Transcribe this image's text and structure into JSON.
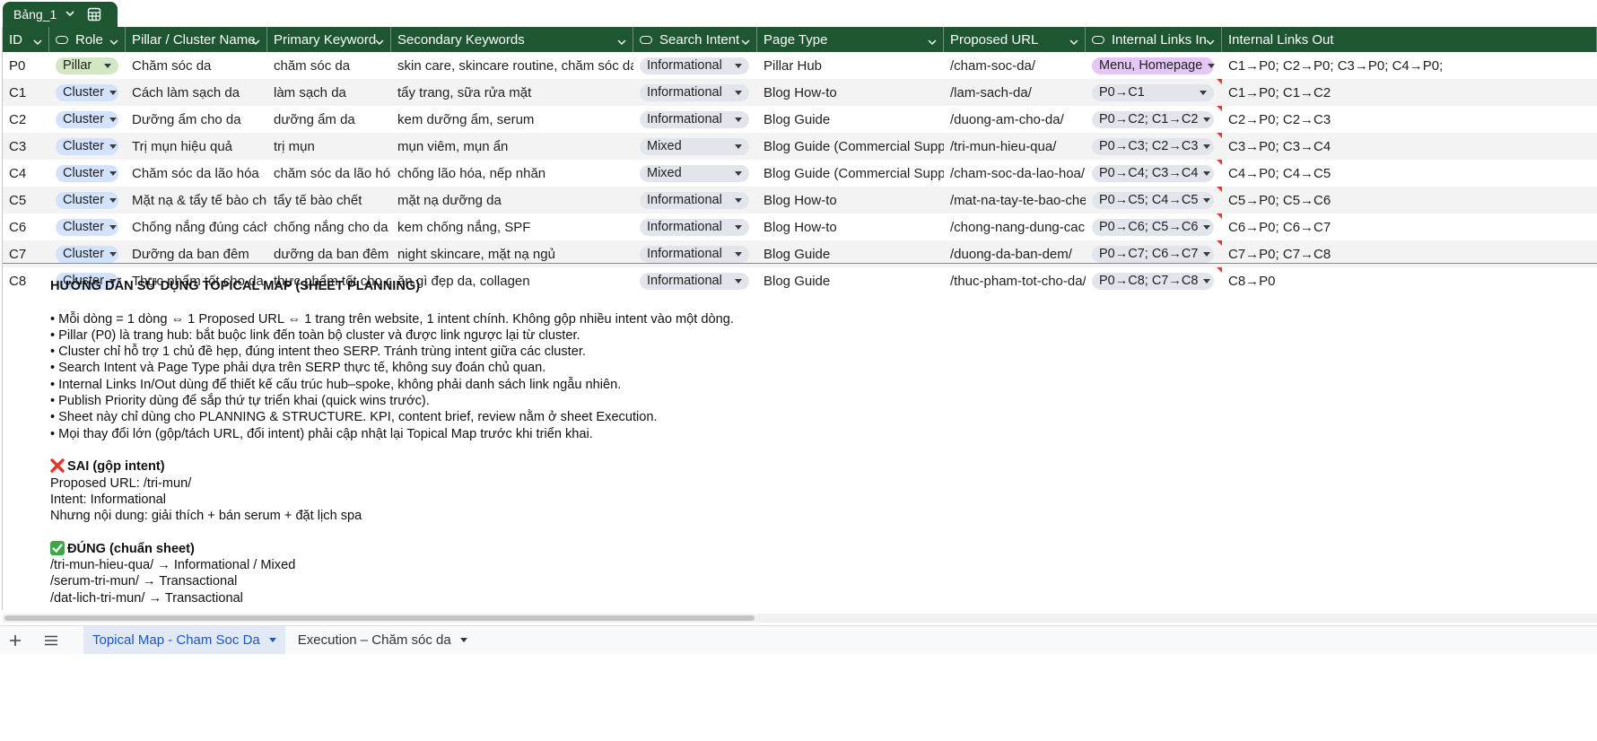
{
  "table_tab": {
    "label": "Bảng_1"
  },
  "columns": [
    {
      "label": "ID",
      "has_icon": false
    },
    {
      "label": "Role",
      "has_icon": true
    },
    {
      "label": "Pillar / Cluster Name",
      "has_icon": false
    },
    {
      "label": "Primary Keyword",
      "has_icon": false
    },
    {
      "label": "Secondary Keywords",
      "has_icon": false
    },
    {
      "label": "Search Intent",
      "has_icon": true
    },
    {
      "label": "Page Type",
      "has_icon": false
    },
    {
      "label": "Proposed URL",
      "has_icon": false
    },
    {
      "label": "Internal Links In",
      "has_icon": true
    },
    {
      "label": "Internal Links Out",
      "has_icon": false
    }
  ],
  "rows": [
    {
      "id": "P0",
      "role": "Pillar",
      "name": "Chăm sóc da",
      "primary": "chăm sóc da",
      "secondary": "skin care, skincare routine, chăm sóc da mặt",
      "intent": "Informational",
      "page_type": "Pillar Hub",
      "url": "/cham-soc-da/",
      "links_in": "Menu, Homepage",
      "links_out": "C1→P0; C2→P0; C3→P0; C4→P0;",
      "note": false
    },
    {
      "id": "C1",
      "role": "Cluster",
      "name": "Cách làm sạch da",
      "primary": "làm sạch da",
      "secondary": "tẩy trang, sữa rửa mặt",
      "intent": "Informational",
      "page_type": "Blog How-to",
      "url": "/lam-sach-da/",
      "links_in": "P0→C1",
      "links_out": "C1→P0; C1→C2",
      "note": true
    },
    {
      "id": "C2",
      "role": "Cluster",
      "name": "Dưỡng ẩm cho da",
      "primary": "dưỡng ẩm da",
      "secondary": "kem dưỡng ẩm, serum",
      "intent": "Informational",
      "page_type": "Blog Guide",
      "url": "/duong-am-cho-da/",
      "links_in": "P0→C2; C1→C2",
      "links_out": "C2→P0; C2→C3",
      "note": true
    },
    {
      "id": "C3",
      "role": "Cluster",
      "name": "Trị mụn hiệu quả",
      "primary": "trị mụn",
      "secondary": "mụn viêm, mụn ẩn",
      "intent": "Mixed",
      "page_type": "Blog Guide (Commercial Support)",
      "url": "/tri-mun-hieu-qua/",
      "links_in": "P0→C3; C2→C3",
      "links_out": "C3→P0; C3→C4",
      "note": true
    },
    {
      "id": "C4",
      "role": "Cluster",
      "name": "Chăm sóc da lão hóa",
      "primary": "chăm sóc da lão hóa",
      "secondary": "chống lão hóa, nếp nhăn",
      "intent": "Mixed",
      "page_type": "Blog Guide (Commercial Support)",
      "url": "/cham-soc-da-lao-hoa/",
      "links_in": "P0→C4; C3→C4",
      "links_out": "C4→P0; C4→C5",
      "note": true
    },
    {
      "id": "C5",
      "role": "Cluster",
      "name": "Mặt nạ & tẩy tế bào chết",
      "primary": "tẩy tế bào chết",
      "secondary": "mặt nạ dưỡng da",
      "intent": "Informational",
      "page_type": "Blog How-to",
      "url": "/mat-na-tay-te-bao-chet/",
      "links_in": "P0→C5; C4→C5",
      "links_out": "C5→P0; C5→C6",
      "note": true
    },
    {
      "id": "C6",
      "role": "Cluster",
      "name": "Chống nắng đúng cách",
      "primary": "chống nắng cho da",
      "secondary": "kem chống nắng, SPF",
      "intent": "Informational",
      "page_type": "Blog How-to",
      "url": "/chong-nang-dung-cach/",
      "links_in": "P0→C6; C5→C6",
      "links_out": "C6→P0; C6→C7",
      "note": true
    },
    {
      "id": "C7",
      "role": "Cluster",
      "name": "Dưỡng da ban đêm",
      "primary": "dưỡng da ban đêm",
      "secondary": "night skincare, mặt nạ ngủ",
      "intent": "Informational",
      "page_type": "Blog Guide",
      "url": "/duong-da-ban-dem/",
      "links_in": "P0→C7; C6→C7",
      "links_out": "C7→P0; C7→C8",
      "note": true
    },
    {
      "id": "C8",
      "role": "Cluster",
      "name": "Thực phẩm tốt cho da",
      "primary": "thực phẩm tốt cho da",
      "secondary": "ăn gì đẹp da, collagen",
      "intent": "Informational",
      "page_type": "Blog Guide",
      "url": "/thuc-pham-tot-cho-da/",
      "links_in": "P0→C8; C7→C8",
      "links_out": "C8→P0",
      "note": true
    }
  ],
  "notes": {
    "title": "HƯỚNG DẪN SỬ DỤNG TOPICAL MAP (SHEET PLANNING)",
    "bullets": [
      "• Mỗi dòng = 1 dòng  ⇔  1 Proposed URL  ⇔  1 trang trên website, 1 intent chính. Không gộp nhiều intent vào một dòng.",
      "• Pillar (P0) là trang hub: bắt buộc link đến toàn bộ cluster và được link ngược lại từ cluster.",
      "• Cluster chỉ hỗ trợ 1 chủ đề hẹp, đúng intent theo SERP. Tránh trùng intent giữa các cluster.",
      "• Search Intent và Page Type phải dựa trên SERP thực tế, không suy đoán chủ quan.",
      "• Internal Links In/Out dùng để thiết kế cấu trúc hub–spoke, không phải danh sách link ngẫu nhiên.",
      "• Publish Priority dùng để sắp thứ tự triển khai (quick wins trước).",
      "• Sheet này chỉ dùng cho PLANNING & STRUCTURE. KPI, content brief, review nằm ở sheet Execution.",
      "• Mọi thay đổi lớn (gộp/tách URL, đổi intent) phải cập nhật lại Topical Map trước khi triển khai."
    ],
    "wrong": {
      "title": "SAI (gộp intent)",
      "lines": [
        "Proposed URL: /tri-mun/",
        "Intent: Informational",
        "Nhưng nội dung: giải thích + bán serum + đặt lịch spa"
      ]
    },
    "right": {
      "title": "ĐÚNG (chuẩn sheet)",
      "lines": [
        "/tri-mun-hieu-qua/ → Informational / Mixed",
        "/serum-tri-mun/ → Transactional",
        "/dat-lich-tri-mun/ → Transactional"
      ]
    }
  },
  "sheet_tabs": [
    {
      "label": "Topical Map - Cham Soc Da",
      "active": true
    },
    {
      "label": "Execution – Chăm sóc da",
      "active": false
    }
  ],
  "colors": {
    "header_bg": "#1e5631",
    "pillar_chip": "#d4e7c5",
    "cluster_chip": "#d3e3fd",
    "intent_chip": "#e2e6ec",
    "links_in_chip": "#e4c7f4",
    "active_tab": "#1a56c4"
  }
}
